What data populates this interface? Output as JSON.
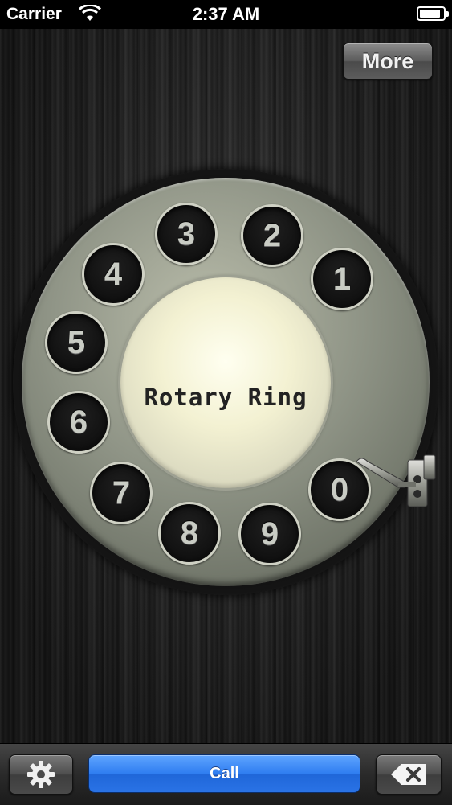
{
  "status_bar": {
    "carrier": "Carrier",
    "time": "2:37 AM",
    "wifi_icon": "wifi-icon",
    "battery_icon": "battery-icon",
    "battery_level": 0.9
  },
  "header": {
    "more_label": "More"
  },
  "dial": {
    "center_label": "Rotary Ring",
    "digits": [
      "1",
      "2",
      "3",
      "4",
      "5",
      "6",
      "7",
      "8",
      "9",
      "0"
    ],
    "finger_stop_icon": "finger-stop-icon"
  },
  "toolbar": {
    "settings_icon": "gear-icon",
    "call_label": "Call",
    "delete_icon": "backspace-icon"
  },
  "colors": {
    "call_button": "#2f7df0",
    "dial_plate": "#8f9486",
    "center_label": "#f3f1d2"
  }
}
